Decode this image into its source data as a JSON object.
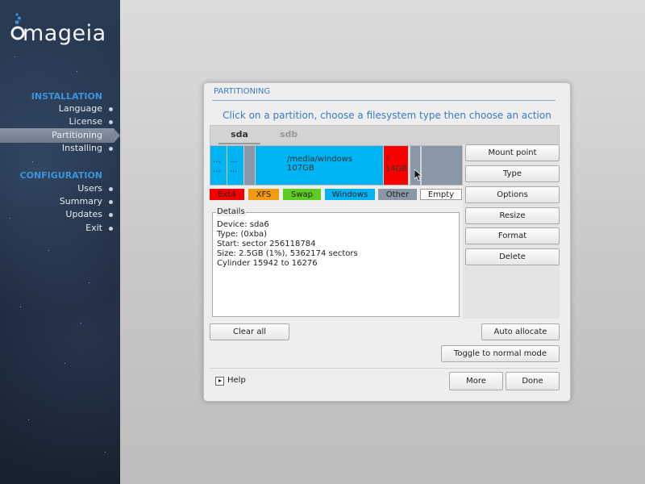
{
  "sidebar": {
    "logo": "mageia",
    "installation_title": "INSTALLATION",
    "installation_items": [
      {
        "label": "Language"
      },
      {
        "label": "License"
      },
      {
        "label": "Partitioning"
      },
      {
        "label": "Installing"
      }
    ],
    "configuration_title": "CONFIGURATION",
    "configuration_items": [
      {
        "label": "Users"
      },
      {
        "label": "Summary"
      },
      {
        "label": "Updates"
      },
      {
        "label": "Exit"
      }
    ],
    "active_item": "Partitioning"
  },
  "dialog": {
    "title": "PARTITIONING",
    "instruction": "Click on a partition, choose a filesystem type then choose an action",
    "tabs": [
      {
        "label": "sda"
      },
      {
        "label": "sdb"
      }
    ],
    "partitions": [
      {
        "top": "...",
        "bottom": "...",
        "color": "#00b4f4"
      },
      {
        "top": "...",
        "bottom": "...",
        "color": "#00b4f4"
      },
      {
        "top": "",
        "bottom": "",
        "color": "#8a97a6"
      },
      {
        "top": "/media/windows",
        "bottom": "107GB",
        "color": "#00b4f4"
      },
      {
        "top": "/",
        "bottom": "14GB",
        "color": "#f70000"
      },
      {
        "top": "",
        "bottom": "",
        "color": "#8a97a6"
      },
      {
        "top": "",
        "bottom": "",
        "color": "#8a97a6"
      }
    ],
    "legend": [
      {
        "label": "Ext4",
        "color": "#f70000"
      },
      {
        "label": "XFS",
        "color": "#f39a11"
      },
      {
        "label": "Swap",
        "color": "#5ecc22"
      },
      {
        "label": "Windows",
        "color": "#00b4f4"
      },
      {
        "label": "Other",
        "color": "#8a97a6"
      },
      {
        "label": "Empty",
        "color": "#ffffff"
      }
    ],
    "details": {
      "legend": "Details",
      "lines": [
        "Device: sda6",
        "Type:  (0xba)",
        "Start: sector 256118784",
        "Size: 2.5GB (1%), 5362174 sectors",
        "Cylinder 15942 to 16276"
      ]
    },
    "actions": [
      {
        "label": "Mount point"
      },
      {
        "label": "Type"
      },
      {
        "label": "Options"
      },
      {
        "label": "Resize"
      },
      {
        "label": "Format"
      },
      {
        "label": "Delete"
      }
    ],
    "clear_all": "Clear all",
    "auto_allocate": "Auto allocate",
    "toggle_mode": "Toggle to normal mode",
    "help": "Help",
    "more": "More",
    "done": "Done"
  }
}
